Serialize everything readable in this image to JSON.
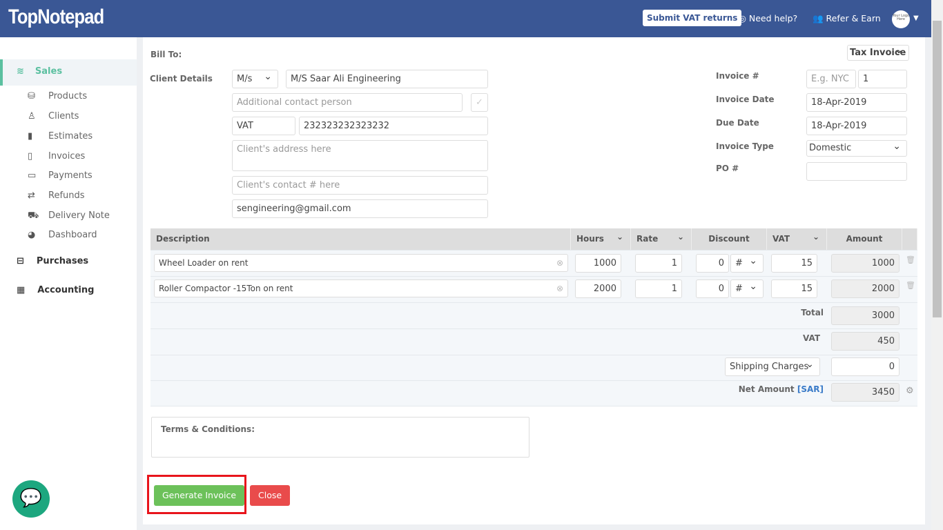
{
  "header": {
    "logo": "TopNotepad",
    "submit_vat": "Submit VAT returns",
    "need_help": "Need help?",
    "refer": "Refer & Earn",
    "avatar_text": "Your Logo Here"
  },
  "sidebar": {
    "sales": "Sales",
    "items": [
      {
        "label": "Products",
        "icon": "cubes"
      },
      {
        "label": "Clients",
        "icon": "user"
      },
      {
        "label": "Estimates",
        "icon": "file"
      },
      {
        "label": "Invoices",
        "icon": "file-outline"
      },
      {
        "label": "Payments",
        "icon": "credit-card"
      },
      {
        "label": "Refunds",
        "icon": "exchange"
      },
      {
        "label": "Delivery Note",
        "icon": "truck"
      },
      {
        "label": "Dashboard",
        "icon": "dashboard"
      }
    ],
    "purchases": "Purchases",
    "accounting": "Accounting"
  },
  "bill": {
    "bill_to": "Bill To:",
    "client_details": "Client Details",
    "title": "M/s",
    "client_name": "M/S Saar Ali Engineering",
    "contact_ph": "Additional contact person",
    "tax_label": "VAT",
    "tax_number": "232323232323232",
    "address_ph": "Client's address here",
    "phone_ph": "Client's contact # here",
    "email": "sengineering@gmail.com"
  },
  "invoice": {
    "doc_type": "Tax Invoice",
    "number_label": "Invoice #",
    "prefix_ph": "E.g. NYC",
    "number": "1",
    "date_label": "Invoice Date",
    "date": "18-Apr-2019",
    "due_label": "Due Date",
    "due": "18-Apr-2019",
    "type_label": "Invoice Type",
    "type": "Domestic",
    "po_label": "PO #",
    "po": ""
  },
  "table": {
    "headers": [
      "Description",
      "Hours",
      "Rate",
      "Discount",
      "VAT",
      "Amount"
    ],
    "rows": [
      {
        "description": "Wheel Loader on rent",
        "hours": "1000",
        "rate": "1",
        "discount": "0",
        "disc_type": "#",
        "vat": "15",
        "amount": "1000"
      },
      {
        "description": "Roller Compactor -15Ton on rent",
        "hours": "2000",
        "rate": "1",
        "discount": "0",
        "disc_type": "#",
        "vat": "15",
        "amount": "2000"
      }
    ],
    "total_label": "Total",
    "total": "3000",
    "vat_label": "VAT",
    "vat": "450",
    "shipping_label": "Shipping Charges",
    "shipping": "0",
    "net_label": "Net Amount",
    "currency": "[SAR]",
    "net": "3450"
  },
  "terms": "Terms & Conditions:",
  "actions": {
    "generate": "Generate Invoice",
    "close": "Close"
  },
  "colors": {
    "header": "#3a5795",
    "accent": "#5bc0a0",
    "generate": "#6cc15a",
    "close": "#e94b4b",
    "highlight": "#e8141b"
  }
}
